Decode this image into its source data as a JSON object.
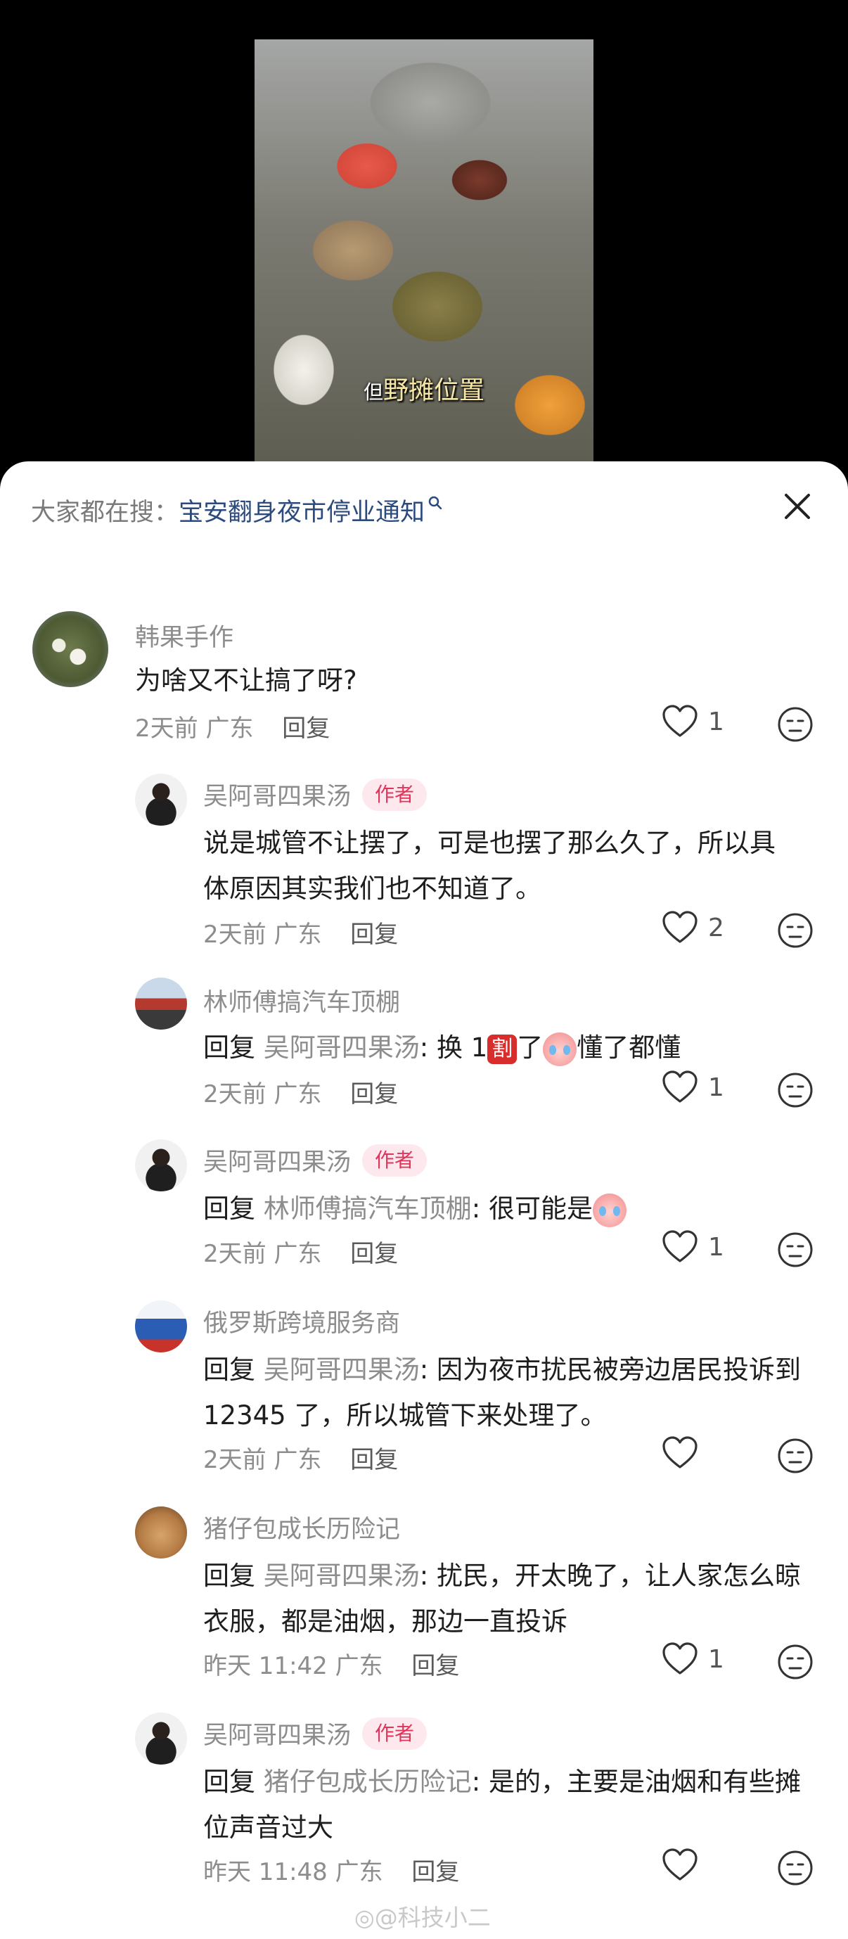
{
  "video": {
    "caption_pre": "但",
    "caption": "野摊位置"
  },
  "search": {
    "prefix": "大家都在搜：",
    "term": "宝安翻身夜市停业通知"
  },
  "comments": [
    {
      "user": "韩果手作",
      "text": "为啥又不让搞了呀?",
      "time": "2天前",
      "location": "广东",
      "reply": "回复",
      "likes": "1"
    },
    {
      "user": "吴阿哥四果汤",
      "badge": "作者",
      "text": "说是城管不让摆了，可是也摆了那么久了，所以具体原因其实我们也不知道了。",
      "time": "2天前",
      "location": "广东",
      "reply": "回复",
      "likes": "2"
    },
    {
      "user": "林师傅搞汽车顶棚",
      "reply_word": "回复",
      "reply_to": "吴阿哥四果汤",
      "text_a": ": 换 1",
      "badge_char": "割",
      "text_b": "了",
      "text_c": "懂了都懂",
      "time": "2天前",
      "location": "广东",
      "reply": "回复",
      "likes": "1"
    },
    {
      "user": "吴阿哥四果汤",
      "badge": "作者",
      "reply_word": "回复",
      "reply_to": "林师傅搞汽车顶棚",
      "text": ": 很可能是",
      "time": "2天前",
      "location": "广东",
      "reply": "回复",
      "likes": "1"
    },
    {
      "user": "俄罗斯跨境服务商",
      "reply_word": "回复",
      "reply_to": "吴阿哥四果汤",
      "text": ": 因为夜市扰民被旁边居民投诉到 12345 了，所以城管下来处理了。",
      "time": "2天前",
      "location": "广东",
      "reply": "回复",
      "likes": ""
    },
    {
      "user": "猪仔包成长历险记",
      "reply_word": "回复",
      "reply_to": "吴阿哥四果汤",
      "text": ": 扰民，开太晚了，让人家怎么晾衣服，都是油烟，那边一直投诉",
      "time": "昨天 11:42",
      "location": "广东",
      "reply": "回复",
      "likes": "1"
    },
    {
      "user": "吴阿哥四果汤",
      "badge": "作者",
      "reply_word": "回复",
      "reply_to": "猪仔包成长历险记",
      "text": ": 是的，主要是油烟和有些摊位声音过大",
      "time": "昨天 11:48",
      "location": "广东",
      "reply": "回复",
      "likes": ""
    }
  ],
  "watermark": "@科技小二"
}
